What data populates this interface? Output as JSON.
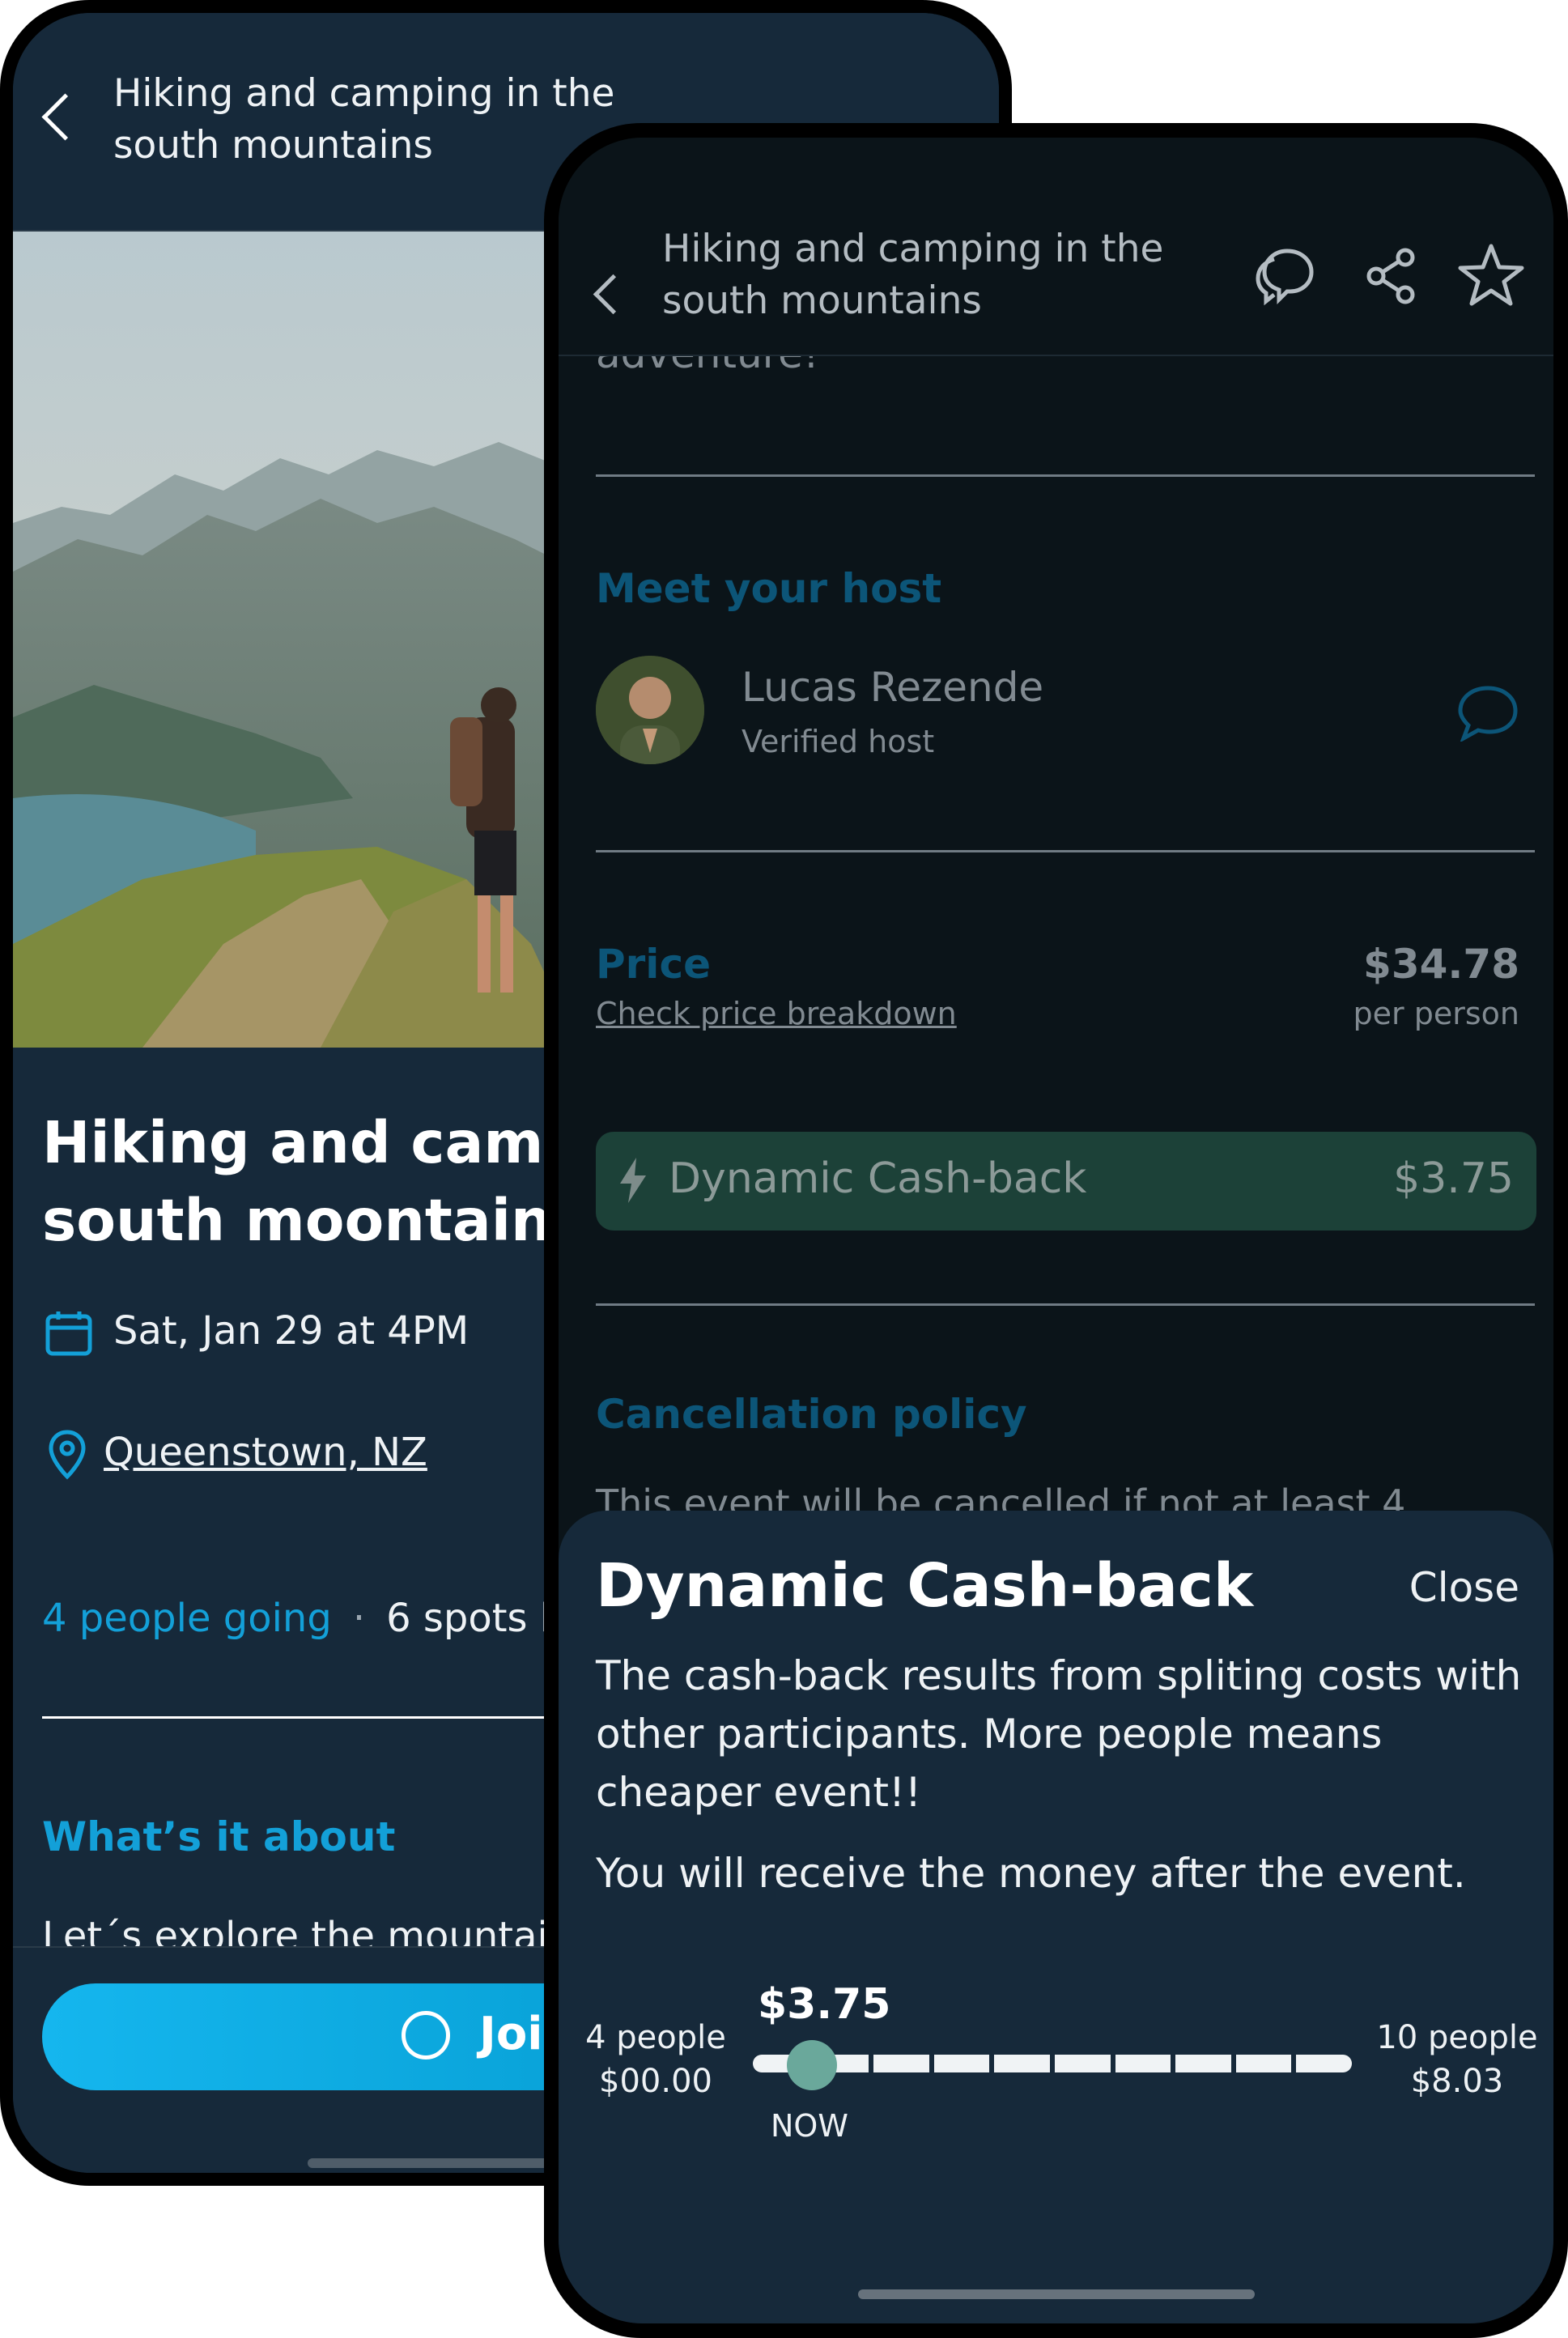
{
  "back_screen": {
    "header_title_line1": "Hiking and camping in the",
    "header_title_line2": "south mountains",
    "event_title_line1": "Hiking and camping in the",
    "event_title_line2": "south moontaintops",
    "date": "Sat, Jan 29 at 4PM",
    "location": "Queenstown, NZ",
    "going": "4 people going",
    "separator": "·",
    "spots": "6 spots left",
    "about_title": "What’s it about",
    "about_text": "Let´s explore the mountains together",
    "join_label": "Join",
    "colors": {
      "background": "#16293a",
      "accent": "#13a0d8"
    }
  },
  "front_screen": {
    "header_title_line1": "Hiking and camping in the",
    "header_title_line2": "south mountains",
    "header_icons": [
      "chat-bubbles-icon",
      "share-icon",
      "star-icon"
    ],
    "scrolled_text": "adventure!",
    "host_section_title": "Meet your host",
    "host_name": "Lucas Rezende",
    "host_status": "Verified host",
    "price_title": "Price",
    "price_link": "Check price breakdown",
    "price_value": "$34.78",
    "price_unit": "per person",
    "cashback_label": "Dynamic Cash-back",
    "cashback_value": "$3.75",
    "cancel_title": "Cancellation policy",
    "cancel_text": "This event will be cancelled if not at least 4"
  },
  "sheet": {
    "title": "Dynamic Cash-back",
    "close_label": "Close",
    "body": "The cash-back results from spliting costs with other participants. More people means cheaper event!!",
    "body2": "You will receive the money after the event.",
    "current_value": "$3.75",
    "now_label": "NOW",
    "min_people": "4 people",
    "min_value": "$00.00",
    "max_people": "10 people",
    "max_value": "$8.03",
    "slider_position": 0.0,
    "colors": {
      "knob": "#6aa89b",
      "sheet_bg": "#16293a"
    }
  }
}
